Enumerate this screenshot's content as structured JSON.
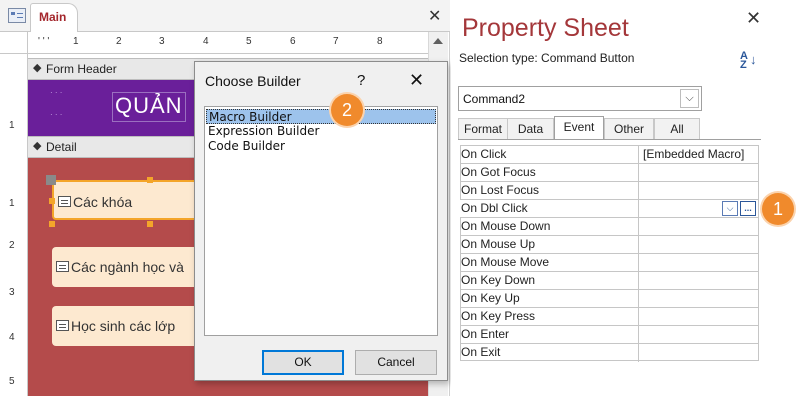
{
  "designer": {
    "tab_label": "Main",
    "close_symbol": "✕",
    "ruler_h": [
      "1",
      "2",
      "3",
      "4",
      "5",
      "6",
      "7",
      "8"
    ],
    "ruler_v": [
      "1",
      "1",
      "2",
      "3",
      "4",
      "5"
    ],
    "form_header_label": "Form Header",
    "detail_label": "Detail",
    "header_title": "QUẢN",
    "header_color": "#6a1f9a",
    "detail_color": "#b44b4b",
    "buttons": [
      {
        "label": "Các khóa"
      },
      {
        "label": "Các ngành học và"
      },
      {
        "label": "Học sinh các lớp"
      }
    ]
  },
  "dialog": {
    "title": "Choose Builder",
    "help": "?",
    "close_symbol": "✕",
    "items": [
      "Macro Builder",
      "Expression Builder",
      "Code Builder"
    ],
    "selected_index": 0,
    "ok_label": "OK",
    "cancel_label": "Cancel"
  },
  "callouts": [
    "1",
    "2"
  ],
  "callout_color": "#f08a2c",
  "property_sheet": {
    "title": "Property Sheet",
    "close_symbol": "✕",
    "selection_type": "Selection type:  Command Button",
    "object_name": "Command2",
    "tabs": [
      "Format",
      "Data",
      "Event",
      "Other",
      "All"
    ],
    "active_tab": "Event",
    "title_color": "#a4373a",
    "properties": [
      {
        "name": "On Click",
        "value": "[Embedded Macro]"
      },
      {
        "name": "On Got Focus",
        "value": ""
      },
      {
        "name": "On Lost Focus",
        "value": ""
      },
      {
        "name": "On Dbl Click",
        "value": ""
      },
      {
        "name": "On Mouse Down",
        "value": ""
      },
      {
        "name": "On Mouse Up",
        "value": ""
      },
      {
        "name": "On Mouse Move",
        "value": ""
      },
      {
        "name": "On Key Down",
        "value": ""
      },
      {
        "name": "On Key Up",
        "value": ""
      },
      {
        "name": "On Key Press",
        "value": ""
      },
      {
        "name": "On Enter",
        "value": ""
      },
      {
        "name": "On Exit",
        "value": ""
      }
    ],
    "dropdown_symbol": "⌵",
    "ellipsis_symbol": "..."
  }
}
